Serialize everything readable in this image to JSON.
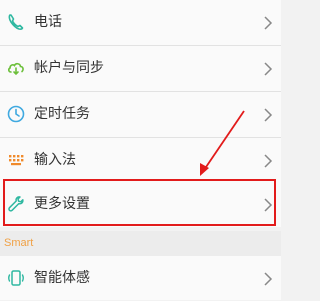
{
  "settings": {
    "items": [
      {
        "label": "电话",
        "icon": "phone-icon"
      },
      {
        "label": "帐户与同步",
        "icon": "cloud-sync-icon"
      },
      {
        "label": "定时任务",
        "icon": "clock-icon"
      },
      {
        "label": "输入法",
        "icon": "keyboard-icon"
      },
      {
        "label": "更多设置",
        "icon": "wrench-icon"
      }
    ],
    "section_title": "Smart",
    "smart_items": [
      {
        "label": "智能体感",
        "icon": "motion-icon"
      }
    ]
  },
  "colors": {
    "accent": "#2fb8a1",
    "highlight": "#e21b1b",
    "section_title": "#f0a145"
  }
}
